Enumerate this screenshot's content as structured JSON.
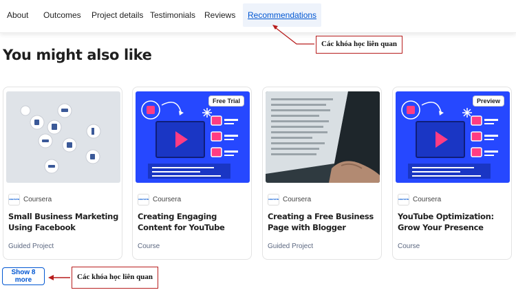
{
  "tabs": [
    {
      "label": "About"
    },
    {
      "label": "Outcomes"
    },
    {
      "label": "Project details"
    },
    {
      "label": "Testimonials"
    },
    {
      "label": "Reviews"
    },
    {
      "label": "Recommendations",
      "active": true
    }
  ],
  "section_title": "You might also like",
  "annotations": {
    "top": "Các khóa học liên quan",
    "bottom": "Các khóa học liên quan",
    "color": "#b71c1c"
  },
  "cards": [
    {
      "title": "Small Business Marketing Using Facebook",
      "partner": "Coursera",
      "type": "Guided Project",
      "badge": ""
    },
    {
      "title": "Creating Engaging Content for YouTube",
      "partner": "Coursera",
      "type": "Course",
      "badge": "Free Trial"
    },
    {
      "title": "Creating a Free Business Page with Blogger",
      "partner": "Coursera",
      "type": "Guided Project",
      "badge": ""
    },
    {
      "title": "YouTube Optimization: Grow Your Presence",
      "partner": "Coursera",
      "type": "Course",
      "badge": "Preview"
    }
  ],
  "partner_logo_text": "coursera",
  "show_more_label": "Show 8 more",
  "colors": {
    "brand": "#0056d2",
    "thumb_blue": "#2648ff",
    "thumb_accent": "#ff3c82"
  }
}
